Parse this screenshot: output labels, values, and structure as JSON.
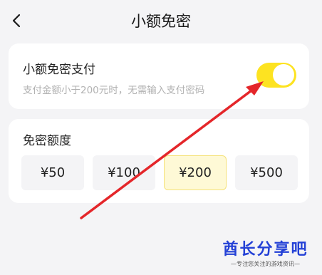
{
  "nav": {
    "title": "小额免密",
    "back_icon": "chevron-left-icon"
  },
  "settings": {
    "title": "小额免密支付",
    "description": "支付金额小于200元时，无需输入支付密码",
    "toggle_on": true,
    "toggle_color": "#fde321"
  },
  "limit": {
    "title": "免密额度",
    "options": [
      "¥50",
      "¥100",
      "¥200",
      "¥500"
    ],
    "selected": "¥200",
    "selected_bg": "#fef9d6"
  },
  "annotation": {
    "arrow_color": "#e4262a"
  },
  "watermark": {
    "brand": "酋长分享吧",
    "slogan": "—专注您关注的游戏资讯—",
    "color": "#2441d6"
  }
}
